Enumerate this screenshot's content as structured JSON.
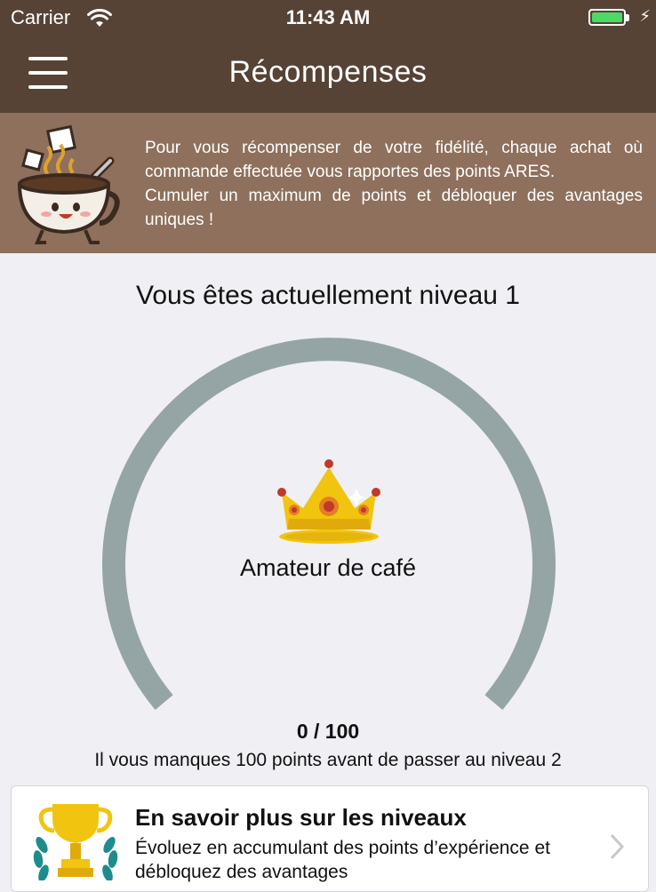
{
  "status_bar": {
    "carrier": "Carrier",
    "time": "11:43 AM",
    "wifi_icon": "wifi-icon",
    "battery_icon": "battery-icon",
    "battery_color": "#4cd964"
  },
  "navbar": {
    "title": "Récompenses",
    "menu_icon": "hamburger-menu-icon",
    "background": "#564336"
  },
  "banner": {
    "mascot_icon": "coffee-cup-mascot-icon",
    "paragraph1": "Pour vous récompenser de votre fidélité, chaque achat où commande effectuée vous rapportes des points ARES.",
    "paragraph2": "Cumuler un maximum de points et débloquer des avantages uniques !",
    "background": "#8e705c"
  },
  "level": {
    "heading": "Vous êtes actuellement niveau 1",
    "name": "Amateur de café",
    "crown_icon": "crown-icon",
    "progress_fraction": 0,
    "gauge_color": "#95a5a6",
    "points_text": "0 / 100",
    "remaining_text": "Il vous manques 100 points avant de passer au niveau 2"
  },
  "info_card": {
    "trophy_icon": "trophy-laurel-icon",
    "title": "En savoir plus sur les niveaux",
    "description": "Évoluez en accumulant des points d’expérience et débloquez des avantages",
    "chevron_icon": "chevron-right-icon"
  }
}
